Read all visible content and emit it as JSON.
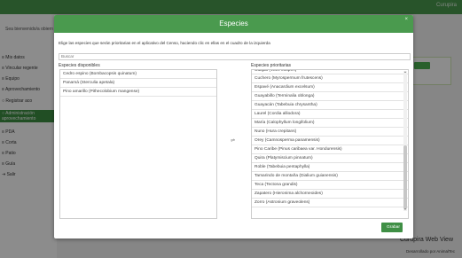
{
  "app": {
    "brand": "Curupira",
    "welcome": "Sea bienvenido/a obiern",
    "footer_title": "Curupira Web View",
    "footer_credit": "Desarrollado por AnimalTec"
  },
  "sidebar": {
    "items": [
      {
        "label": "≡ Mis datos"
      },
      {
        "label": "≡ Vincular regente"
      },
      {
        "label": "≡ Equipo"
      },
      {
        "label": "≡ Aprovechamiento"
      },
      {
        "label": "○ Registrar aco"
      },
      {
        "label": "○ Administración aprovechamiento"
      },
      {
        "label": "≡ PDA"
      },
      {
        "label": "≡ Corta"
      },
      {
        "label": "≡ Patio"
      },
      {
        "label": "≡ Guía"
      },
      {
        "label": "⇥ Salir"
      }
    ]
  },
  "modal": {
    "title": "Especies",
    "close": "×",
    "instructions": "Elige las especies que serán prioritarias en el aplicativo del Censo, haciendo clic en ellas en el cuadro de la izquierda",
    "search_placeholder": "Buscar",
    "available_label": "Especies disponibles",
    "priority_label": "Especies prioritarias",
    "available": [
      "Cedro espino (Bombacopsis quinatum)",
      "Panamá (Sterculia apetala)",
      "Pino amarillo (Pithecolobium mangense)"
    ],
    "priority_partial": "Cuajao (Vitex cooperi)",
    "priority": [
      "Cuchero (Myrospermum frutescens)",
      "Espavé (Anacardium excelsum)",
      "Guayabillo (Terminalia oblonga)",
      "Guayacán (Tabebuia chrysantha)",
      "Laurel (Cordia alliodora)",
      "María (Calophyllum longifolium)",
      "Nuno (Hura crepitans)",
      "Orey (Camnosperma panamensis)",
      "Pino Caribe (Pinus caribaea var. Hondurensis)",
      "Quira (Platymiscium pinnatum)",
      "Roble (Tabebuia pentaphylla)",
      "Tamarindo de montaña (Dialium guianensis)",
      "Teca (Tectona grandis)",
      "Zapatero (Hieronima alchorneoides)",
      "Zorro (Astronium graveolens)"
    ],
    "save_label": "Grabar"
  },
  "colors": {
    "header_green": "#4a9a4e",
    "button_green": "#3f8f45"
  }
}
